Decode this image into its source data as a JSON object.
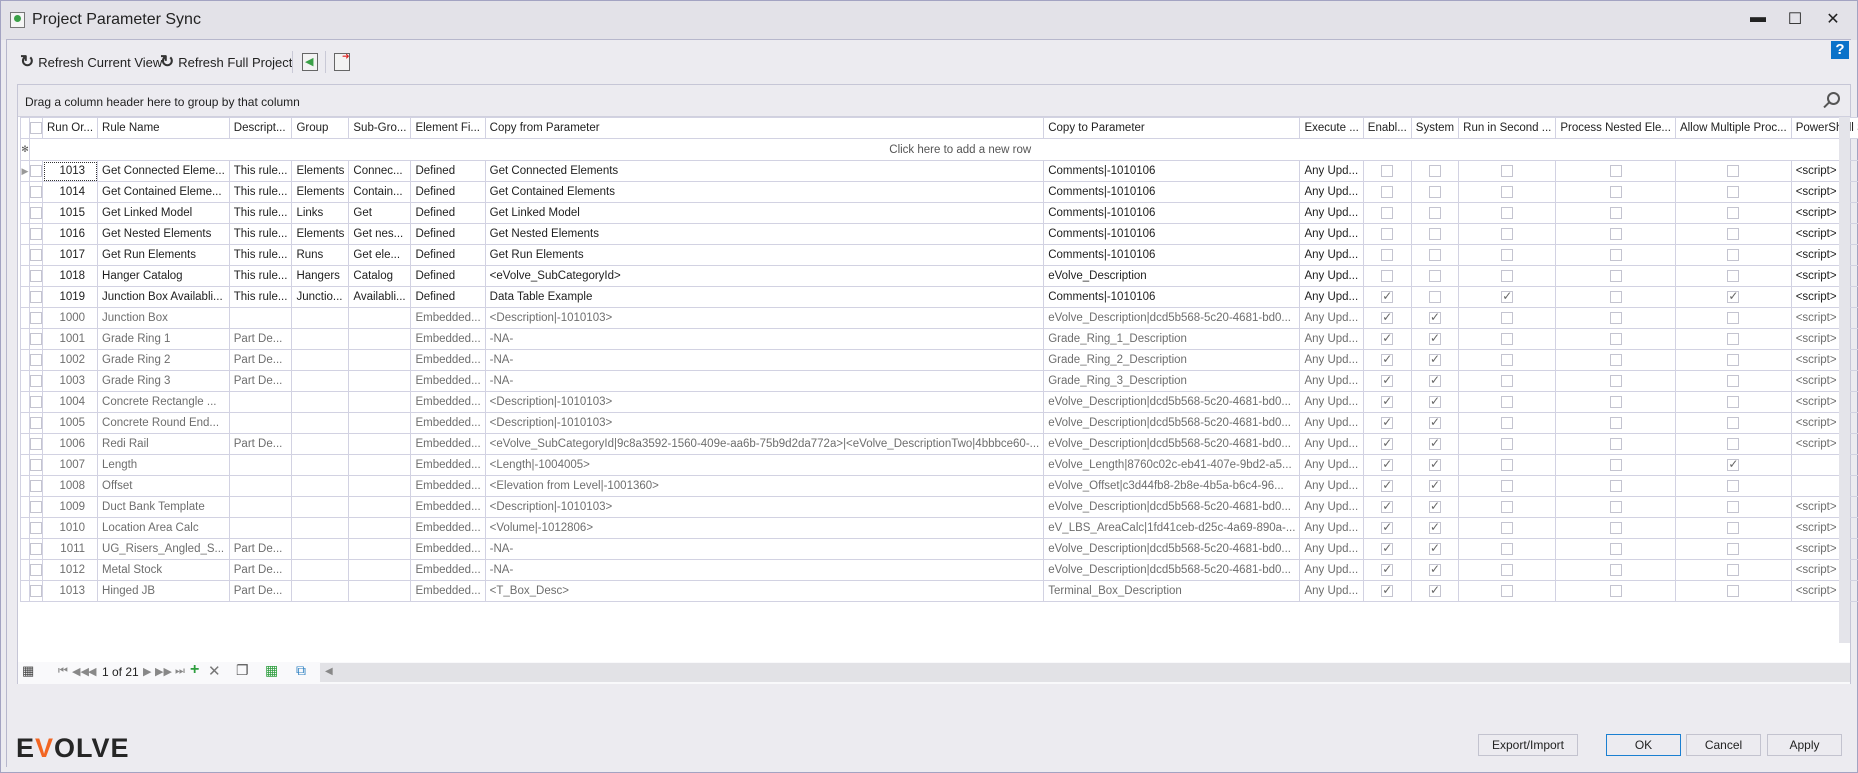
{
  "window": {
    "title": "Project Parameter Sync"
  },
  "toolbar": {
    "refresh_current": "Refresh Current View",
    "refresh_full": "Refresh Full Project"
  },
  "grid": {
    "group_hint": "Drag a column header here to group by that column",
    "new_row_hint": "Click here to add a new row",
    "columns": [
      "Run Or...",
      "Rule Name",
      "Descript...",
      "Group",
      "Sub-Gro...",
      "Element Fi...",
      "Copy from Parameter",
      "Copy to Parameter",
      "Execute ...",
      "Enabl...",
      "System",
      "Run in Second ...",
      "Process Nested Ele...",
      "Allow Multiple Proc...",
      "PowerShell Script"
    ],
    "rows": [
      {
        "run": "1013",
        "name": "Get Connected Eleme...",
        "desc": "This rule...",
        "group": "Elements",
        "sub": "Connec...",
        "elem": "Defined",
        "from": "Get Connected Elements",
        "to": "Comments|-1010106",
        "exec": "Any Upd...",
        "enabled": false,
        "system": false,
        "second": false,
        "nested": false,
        "multiple": false,
        "script": "<script>",
        "dim": false
      },
      {
        "run": "1014",
        "name": "Get Contained Eleme...",
        "desc": "This rule...",
        "group": "Elements",
        "sub": "Contain...",
        "elem": "Defined",
        "from": "Get Contained Elements",
        "to": "Comments|-1010106",
        "exec": "Any Upd...",
        "enabled": false,
        "system": false,
        "second": false,
        "nested": false,
        "multiple": false,
        "script": "<script>",
        "dim": false
      },
      {
        "run": "1015",
        "name": "Get Linked Model",
        "desc": "This rule...",
        "group": "Links",
        "sub": "Get",
        "elem": "Defined",
        "from": "Get Linked Model",
        "to": "Comments|-1010106",
        "exec": "Any Upd...",
        "enabled": false,
        "system": false,
        "second": false,
        "nested": false,
        "multiple": false,
        "script": "<script>",
        "dim": false
      },
      {
        "run": "1016",
        "name": "Get Nested Elements",
        "desc": "This rule...",
        "group": "Elements",
        "sub": "Get nes...",
        "elem": "Defined",
        "from": "Get Nested Elements",
        "to": "Comments|-1010106",
        "exec": "Any Upd...",
        "enabled": false,
        "system": false,
        "second": false,
        "nested": false,
        "multiple": false,
        "script": "<script>",
        "dim": false
      },
      {
        "run": "1017",
        "name": "Get Run Elements",
        "desc": "This rule...",
        "group": "Runs",
        "sub": "Get ele...",
        "elem": "Defined",
        "from": "Get Run Elements",
        "to": "Comments|-1010106",
        "exec": "Any Upd...",
        "enabled": false,
        "system": false,
        "second": false,
        "nested": false,
        "multiple": false,
        "script": "<script>",
        "dim": false
      },
      {
        "run": "1018",
        "name": "Hanger Catalog",
        "desc": "This rule...",
        "group": "Hangers",
        "sub": "Catalog",
        "elem": "Defined",
        "from": "<eVolve_SubCategoryId>",
        "to": "eVolve_Description",
        "exec": "Any Upd...",
        "enabled": false,
        "system": false,
        "second": false,
        "nested": false,
        "multiple": false,
        "script": "<script>",
        "dim": false
      },
      {
        "run": "1019",
        "name": "Junction Box Availabli...",
        "desc": "This rule...",
        "group": "Junctio...",
        "sub": "Availabli...",
        "elem": "Defined",
        "from": "Data Table Example",
        "to": "Comments|-1010106",
        "exec": "Any Upd...",
        "enabled": true,
        "system": false,
        "second": true,
        "nested": false,
        "multiple": true,
        "script": "<script>",
        "dim": false
      },
      {
        "run": "1000",
        "name": "Junction Box",
        "desc": "",
        "group": "",
        "sub": "",
        "elem": "Embedded...",
        "from": "<Description|-1010103>",
        "to": "eVolve_Description|dcd5b568-5c20-4681-bd0...",
        "exec": "Any Upd...",
        "enabled": true,
        "system": true,
        "second": false,
        "nested": false,
        "multiple": false,
        "script": "<script>",
        "dim": true
      },
      {
        "run": "1001",
        "name": "Grade Ring 1",
        "desc": "Part De...",
        "group": "",
        "sub": "",
        "elem": "Embedded...",
        "from": "-NA-",
        "to": "Grade_Ring_1_Description",
        "exec": "Any Upd...",
        "enabled": true,
        "system": true,
        "second": false,
        "nested": false,
        "multiple": false,
        "script": "<script>",
        "dim": true
      },
      {
        "run": "1002",
        "name": "Grade Ring 2",
        "desc": "Part De...",
        "group": "",
        "sub": "",
        "elem": "Embedded...",
        "from": "-NA-",
        "to": "Grade_Ring_2_Description",
        "exec": "Any Upd...",
        "enabled": true,
        "system": true,
        "second": false,
        "nested": false,
        "multiple": false,
        "script": "<script>",
        "dim": true
      },
      {
        "run": "1003",
        "name": "Grade Ring 3",
        "desc": "Part De...",
        "group": "",
        "sub": "",
        "elem": "Embedded...",
        "from": "-NA-",
        "to": "Grade_Ring_3_Description",
        "exec": "Any Upd...",
        "enabled": true,
        "system": true,
        "second": false,
        "nested": false,
        "multiple": false,
        "script": "<script>",
        "dim": true
      },
      {
        "run": "1004",
        "name": "Concrete Rectangle ...",
        "desc": "",
        "group": "",
        "sub": "",
        "elem": "Embedded...",
        "from": "<Description|-1010103>",
        "to": "eVolve_Description|dcd5b568-5c20-4681-bd0...",
        "exec": "Any Upd...",
        "enabled": true,
        "system": true,
        "second": false,
        "nested": false,
        "multiple": false,
        "script": "<script>",
        "dim": true
      },
      {
        "run": "1005",
        "name": "Concrete Round End...",
        "desc": "",
        "group": "",
        "sub": "",
        "elem": "Embedded...",
        "from": "<Description|-1010103>",
        "to": "eVolve_Description|dcd5b568-5c20-4681-bd0...",
        "exec": "Any Upd...",
        "enabled": true,
        "system": true,
        "second": false,
        "nested": false,
        "multiple": false,
        "script": "<script>",
        "dim": true
      },
      {
        "run": "1006",
        "name": "Redi Rail",
        "desc": "Part De...",
        "group": "",
        "sub": "",
        "elem": "Embedded...",
        "from": "<eVolve_SubCategoryId|9c8a3592-1560-409e-aa6b-75b9d2da772a>|<eVolve_DescriptionTwo|4bbbce60-...",
        "to": "eVolve_Description|dcd5b568-5c20-4681-bd0...",
        "exec": "Any Upd...",
        "enabled": true,
        "system": true,
        "second": false,
        "nested": false,
        "multiple": false,
        "script": "<script>",
        "dim": true
      },
      {
        "run": "1007",
        "name": "Length",
        "desc": "",
        "group": "",
        "sub": "",
        "elem": "Embedded...",
        "from": "<Length|-1004005>",
        "to": "eVolve_Length|8760c02c-eb41-407e-9bd2-a5...",
        "exec": "Any Upd...",
        "enabled": true,
        "system": true,
        "second": false,
        "nested": false,
        "multiple": true,
        "script": "",
        "dim": true
      },
      {
        "run": "1008",
        "name": "Offset",
        "desc": "",
        "group": "",
        "sub": "",
        "elem": "Embedded...",
        "from": "<Elevation from Level|-1001360>",
        "to": "eVolve_Offset|c3d44fb8-2b8e-4b5a-b6c4-96...",
        "exec": "Any Upd...",
        "enabled": true,
        "system": true,
        "second": false,
        "nested": false,
        "multiple": false,
        "script": "",
        "dim": true
      },
      {
        "run": "1009",
        "name": "Duct Bank Template",
        "desc": "",
        "group": "",
        "sub": "",
        "elem": "Embedded...",
        "from": "<Description|-1010103>",
        "to": "eVolve_Description|dcd5b568-5c20-4681-bd0...",
        "exec": "Any Upd...",
        "enabled": true,
        "system": true,
        "second": false,
        "nested": false,
        "multiple": false,
        "script": "<script>",
        "dim": true
      },
      {
        "run": "1010",
        "name": "Location Area Calc",
        "desc": "",
        "group": "",
        "sub": "",
        "elem": "Embedded...",
        "from": "<Volume|-1012806>",
        "to": "eV_LBS_AreaCalc|1fd41ceb-d25c-4a69-890a-...",
        "exec": "Any Upd...",
        "enabled": true,
        "system": true,
        "second": false,
        "nested": false,
        "multiple": false,
        "script": "<script>",
        "dim": true
      },
      {
        "run": "1011",
        "name": "UG_Risers_Angled_S...",
        "desc": "Part De...",
        "group": "",
        "sub": "",
        "elem": "Embedded...",
        "from": "-NA-",
        "to": "eVolve_Description|dcd5b568-5c20-4681-bd0...",
        "exec": "Any Upd...",
        "enabled": true,
        "system": true,
        "second": false,
        "nested": false,
        "multiple": false,
        "script": "<script>",
        "dim": true
      },
      {
        "run": "1012",
        "name": "Metal Stock",
        "desc": "Part De...",
        "group": "",
        "sub": "",
        "elem": "Embedded...",
        "from": "-NA-",
        "to": "eVolve_Description|dcd5b568-5c20-4681-bd0...",
        "exec": "Any Upd...",
        "enabled": true,
        "system": true,
        "second": false,
        "nested": false,
        "multiple": false,
        "script": "<script>",
        "dim": true
      },
      {
        "run": "1013",
        "name": "Hinged JB",
        "desc": "Part De...",
        "group": "",
        "sub": "",
        "elem": "Embedded...",
        "from": "<T_Box_Desc>",
        "to": "Terminal_Box_Description",
        "exec": "Any Upd...",
        "enabled": true,
        "system": true,
        "second": false,
        "nested": false,
        "multiple": false,
        "script": "<script>",
        "dim": true
      }
    ]
  },
  "navigator": {
    "page_text": "1 of 21"
  },
  "footer": {
    "logo": "EVOLVE",
    "export_import": "Export/Import",
    "ok": "OK",
    "cancel": "Cancel",
    "apply": "Apply"
  },
  "colors": {
    "accent": "#0a72c9",
    "logo_v": "#f26522",
    "add": "#2e9e3e"
  }
}
